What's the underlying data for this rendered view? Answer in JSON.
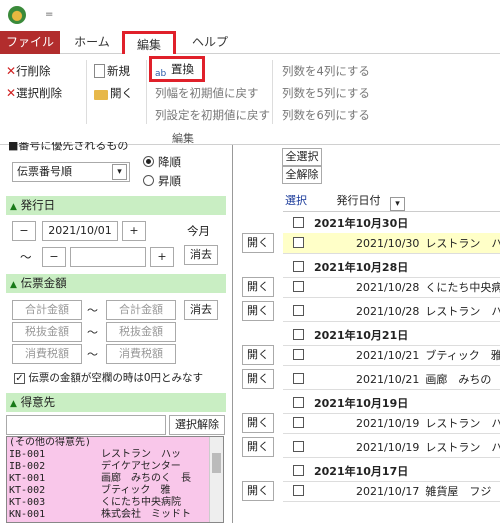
{
  "titlebar": {
    "quick_access": "="
  },
  "tabs": {
    "file": "ファイル",
    "home": "ホーム",
    "edit": "編集",
    "help": "ヘルプ"
  },
  "ribbon": {
    "delete_row": "行削除",
    "delete_selected": "選択削除",
    "new": "新規",
    "open": "開く",
    "replace": "置換",
    "reset_col_width": "列幅を初期値に戻す",
    "reset_col_settings": "列設定を初期値に戻す",
    "cols4": "列数を4列にする",
    "cols5": "列数を5列にする",
    "cols6": "列数を6列にする",
    "group_label": "編集"
  },
  "left": {
    "top_partial": "■番号に優先されるもの",
    "sort_field": "伝票番号順",
    "desc": "降順",
    "asc": "昇順",
    "issue_date_header": "発行日",
    "minus": "−",
    "plus": "+",
    "date_from": "2021/10/01",
    "date_to": "",
    "tilde": "〜",
    "this_month": "今月",
    "clear": "消去",
    "amount_header": "伝票金額",
    "total_amount": "合計金額",
    "pretax_amount": "税抜金額",
    "tax_amount": "消費税額",
    "zero_checkbox_label": "伝票の金額が空欄の時は0円とみなす",
    "customer_header": "得意先",
    "clear_selection": "選択解除",
    "customers": [
      {
        "code": "(その他の得意先)",
        "name": ""
      },
      {
        "code": "IB-001",
        "name": "レストラン　ハッ"
      },
      {
        "code": "IB-002",
        "name": "デイケアセンター"
      },
      {
        "code": "KT-001",
        "name": "画廊　みちのく　長"
      },
      {
        "code": "KT-002",
        "name": "ブティック　雅"
      },
      {
        "code": "KT-003",
        "name": "くにたち中央病院"
      },
      {
        "code": "KN-001",
        "name": "株式会社　ミッドト"
      }
    ]
  },
  "right": {
    "select_all": "全選択",
    "deselect_all": "全解除",
    "col_select": "選択",
    "col_date": "発行日付",
    "open": "開く",
    "rows": [
      {
        "type": "group",
        "text": "2021年10月30日"
      },
      {
        "type": "item",
        "date": "2021/10/30",
        "name": "レストラン　ハ",
        "highlight": true
      },
      {
        "type": "group",
        "text": "2021年10月28日"
      },
      {
        "type": "item",
        "date": "2021/10/28",
        "name": "くにたち中央病"
      },
      {
        "type": "item",
        "date": "2021/10/28",
        "name": "レストラン　ハ"
      },
      {
        "type": "group",
        "text": "2021年10月21日"
      },
      {
        "type": "item",
        "date": "2021/10/21",
        "name": "ブティック　雅"
      },
      {
        "type": "item",
        "date": "2021/10/21",
        "name": "画廊　みちの"
      },
      {
        "type": "group",
        "text": "2021年10月19日"
      },
      {
        "type": "item",
        "date": "2021/10/19",
        "name": "レストラン　ハ"
      },
      {
        "type": "item",
        "date": "2021/10/19",
        "name": "レストラン　ハ"
      },
      {
        "type": "group",
        "text": "2021年10月17日"
      },
      {
        "type": "item",
        "date": "2021/10/17",
        "name": "雑貨屋　フジ"
      }
    ]
  }
}
